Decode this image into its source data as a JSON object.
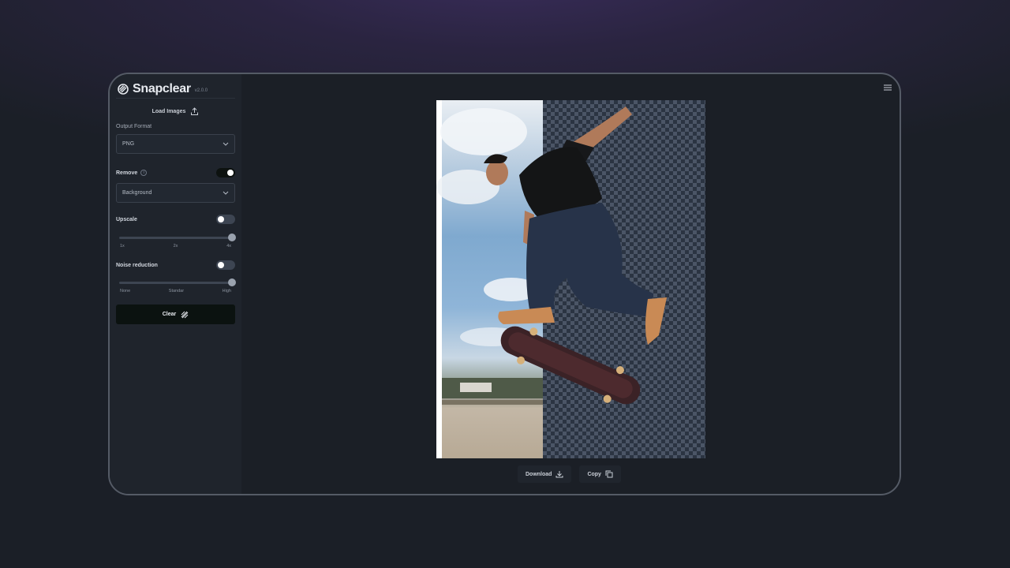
{
  "app": {
    "name": "Snapclear",
    "version": "v2.0.0"
  },
  "sidebar": {
    "load_label": "Load Images",
    "output_format": {
      "label": "Output Format",
      "value": "PNG"
    },
    "remove": {
      "label": "Remove",
      "enabled": true,
      "value": "Background"
    },
    "upscale": {
      "label": "Upscale",
      "enabled": false,
      "level": 1.0,
      "ticks": [
        "1x",
        "2x",
        "4x"
      ]
    },
    "noise": {
      "label": "Noise reduction",
      "enabled": false,
      "level": 1.0,
      "ticks": [
        "None",
        "Standar",
        "High"
      ]
    },
    "clear_label": "Clear"
  },
  "actions": {
    "download_label": "Download",
    "copy_label": "Copy"
  },
  "colors": {
    "accent_dark": "#0b1210",
    "panel": "#1f242c",
    "checker_light": "#4b5566",
    "checker_dark": "#2b3442"
  },
  "icons": {
    "logo": "snapclear-logo-icon",
    "upload": "upload-icon",
    "chevron": "chevron-down-icon",
    "info": "info-icon",
    "clear": "stripes-icon",
    "download": "download-icon",
    "copy": "copy-icon",
    "menu": "hamburger-menu-icon"
  }
}
